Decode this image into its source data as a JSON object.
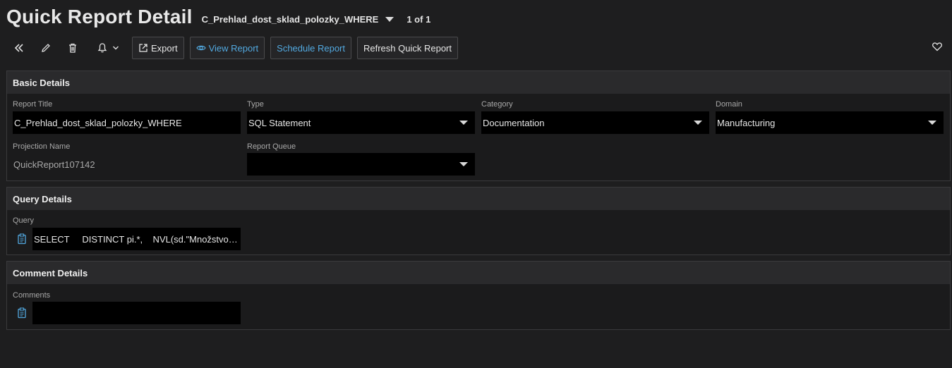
{
  "header": {
    "title": "Quick Report Detail",
    "record_name": "C_Prehlad_dost_sklad_polozky_WHERE",
    "record_count": "1 of 1"
  },
  "toolbar": {
    "export_label": "Export",
    "view_report_label": "View Report",
    "schedule_report_label": "Schedule Report",
    "refresh_label": "Refresh Quick Report",
    "icons": [
      "double-chevron-left-icon",
      "pencil-icon",
      "trash-icon",
      "bell-icon",
      "chevron-down-icon",
      "heart-icon"
    ]
  },
  "basic_details": {
    "heading": "Basic Details",
    "report_title": {
      "label": "Report Title",
      "value": "C_Prehlad_dost_sklad_polozky_WHERE"
    },
    "type": {
      "label": "Type",
      "value": "SQL Statement"
    },
    "category": {
      "label": "Category",
      "value": "Documentation"
    },
    "domain": {
      "label": "Domain",
      "value": "Manufacturing"
    },
    "projection_name": {
      "label": "Projection Name",
      "value": "QuickReport107142"
    },
    "report_queue": {
      "label": "Report Queue",
      "value": ""
    }
  },
  "query_details": {
    "heading": "Query Details",
    "query": {
      "label": "Query",
      "value": "SELECT     DISTINCT pi.*,    NVL(sd.\"Množstvo doda..."
    }
  },
  "comment_details": {
    "heading": "Comment Details",
    "comments": {
      "label": "Comments",
      "value": ""
    }
  },
  "colors": {
    "background": "#1e1e1f",
    "panel_header": "#2a2a2c",
    "field_bg": "#000000",
    "accent": "#52a9e0"
  }
}
